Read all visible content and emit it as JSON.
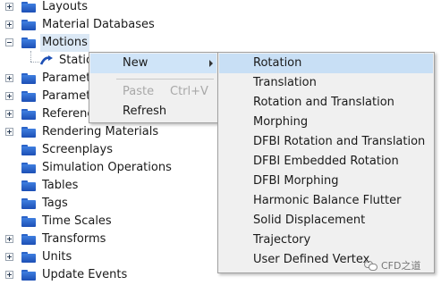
{
  "tree": {
    "items": [
      {
        "label": "Layouts",
        "expander": "plus"
      },
      {
        "label": "Material Databases",
        "expander": "plus"
      },
      {
        "label": "Motions",
        "expander": "minus"
      },
      {
        "label": "Station",
        "expander": "none"
      },
      {
        "label": "Paramet",
        "expander": "plus"
      },
      {
        "label": "Paramet",
        "expander": "plus"
      },
      {
        "label": "Referenc",
        "expander": "plus"
      },
      {
        "label": "Rendering Materials",
        "expander": "plus"
      },
      {
        "label": "Screenplays",
        "expander": "none"
      },
      {
        "label": "Simulation Operations",
        "expander": "none"
      },
      {
        "label": "Tables",
        "expander": "none"
      },
      {
        "label": "Tags",
        "expander": "none"
      },
      {
        "label": "Time Scales",
        "expander": "none"
      },
      {
        "label": "Transforms",
        "expander": "plus"
      },
      {
        "label": "Units",
        "expander": "plus"
      },
      {
        "label": "Update Events",
        "expander": "plus"
      }
    ]
  },
  "context_menu": {
    "new": "New",
    "paste": "Paste",
    "paste_shortcut": "Ctrl+V",
    "refresh": "Refresh"
  },
  "submenu": {
    "items": [
      "Rotation",
      "Translation",
      "Rotation and Translation",
      "Morphing",
      "DFBI Rotation and Translation",
      "DFBI Embedded Rotation",
      "DFBI Morphing",
      "Harmonic Balance Flutter",
      "Solid Displacement",
      "Trajectory",
      "User Defined Vertex"
    ],
    "highlighted_index": 0
  },
  "watermark": {
    "text": "CFD之道"
  },
  "colors": {
    "folder": "#2a63c8",
    "menu_background": "#f0f0f0",
    "highlight": "#cfe4f8",
    "selection": "#dbe8f5"
  }
}
